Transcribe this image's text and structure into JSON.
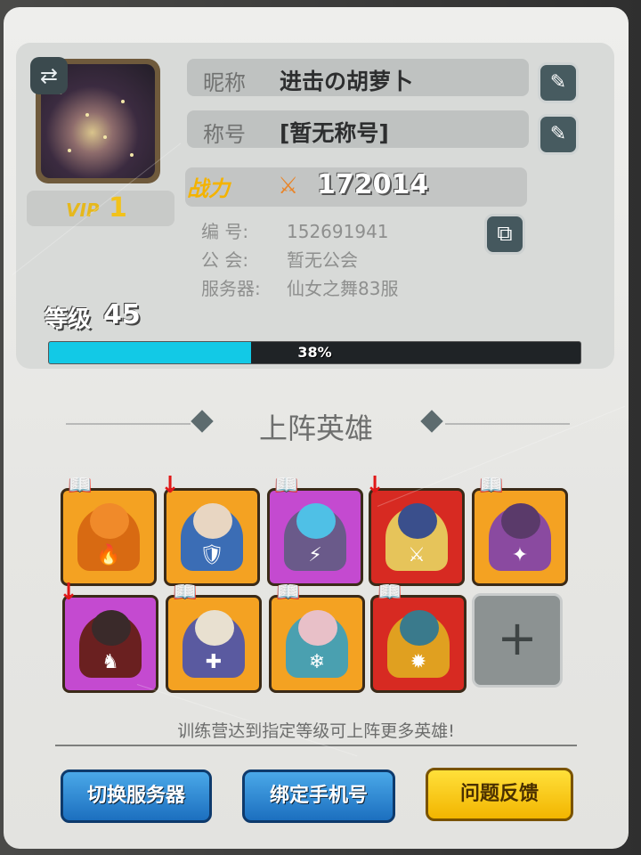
{
  "profile": {
    "nickname_label": "昵称",
    "nickname_value": "进击の胡萝卜",
    "title_label": "称号",
    "title_value": "[暂无称号]",
    "power_label": "战力",
    "power_value": "172014",
    "vip_label": "VIP",
    "vip_level": "1",
    "id_label": "编  号:",
    "id_value": "152691941",
    "guild_label": "公  会:",
    "guild_value": "暂无公会",
    "server_label": "服务器:",
    "server_value": "仙女之舞83服",
    "level_label": "等级",
    "level_value": "45",
    "xp_percent": 38,
    "xp_text": "38%"
  },
  "section": {
    "title": "上阵英雄"
  },
  "heroes": [
    {
      "frame": "orange",
      "badge": "book",
      "glyph": "🔥",
      "body": "#d86a12",
      "head": "#f08a2a"
    },
    {
      "frame": "orange",
      "badge": "arrow",
      "glyph": "🛡",
      "body": "#3b6db5",
      "head": "#e8d6c2"
    },
    {
      "frame": "purple",
      "badge": "book",
      "glyph": "⚡",
      "body": "#6a5a8a",
      "head": "#4fc0e6"
    },
    {
      "frame": "red",
      "badge": "arrow",
      "glyph": "⚔",
      "body": "#e6c45a",
      "head": "#3a4f8c"
    },
    {
      "frame": "orange",
      "badge": "book",
      "glyph": "✦",
      "body": "#8a4aa0",
      "head": "#5a3a6a"
    },
    {
      "frame": "purple",
      "badge": "arrow",
      "glyph": "♞",
      "body": "#6a2020",
      "head": "#3a2a2a"
    },
    {
      "frame": "orange",
      "badge": "book",
      "glyph": "✚",
      "body": "#5a5aa0",
      "head": "#e8e0d0"
    },
    {
      "frame": "orange",
      "badge": "book",
      "glyph": "❄",
      "body": "#4aa0b0",
      "head": "#e8c0c8"
    },
    {
      "frame": "red",
      "badge": "book",
      "glyph": "✹",
      "body": "#e0a020",
      "head": "#3a7a8c"
    }
  ],
  "colors": {
    "orange": "#f4a222",
    "purple": "#c44ad0",
    "red": "#d72a22"
  },
  "hint": "训练营达到指定等级可上阵更多英雄!",
  "buttons": {
    "switch_server": "切换服务器",
    "bind_phone": "绑定手机号",
    "feedback": "问题反馈"
  },
  "icons": {
    "swap": "swap-icon",
    "edit": "pencil-icon",
    "copy": "copy-icon",
    "power": "crossed-swords-icon",
    "add": "plus-icon"
  }
}
